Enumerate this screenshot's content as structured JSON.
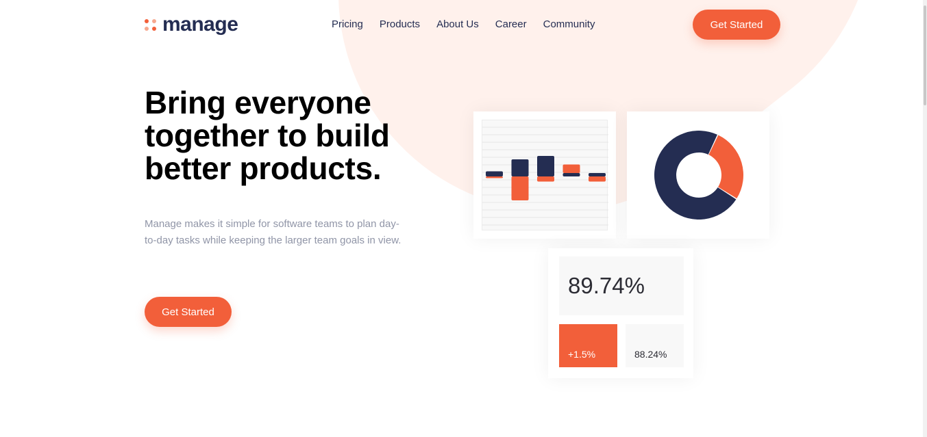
{
  "brand": {
    "name": "manage"
  },
  "nav": {
    "items": [
      "Pricing",
      "Products",
      "About Us",
      "Career",
      "Community"
    ]
  },
  "header": {
    "cta_label": "Get Started"
  },
  "hero": {
    "title": "Bring everyone together to build better products.",
    "description": "Manage makes it simple for software teams to plan day-to-day tasks while keeping the larger team goals in view.",
    "cta_label": "Get Started"
  },
  "stats": {
    "main": "89.74%",
    "change": "+1.5%",
    "secondary": "88.24%"
  },
  "colors": {
    "accent": "#f25f3a",
    "navy": "#242d52",
    "bg_tint": "#fff1ec",
    "muted_text": "#9095a7"
  },
  "chart_data": [
    {
      "type": "bar",
      "series": [
        {
          "values": [
            3,
            10,
            12,
            2,
            2
          ]
        },
        {
          "values": [
            -1,
            -14,
            -3,
            5,
            -3
          ]
        }
      ]
    },
    {
      "type": "pie",
      "values": [
        27,
        73
      ]
    }
  ]
}
